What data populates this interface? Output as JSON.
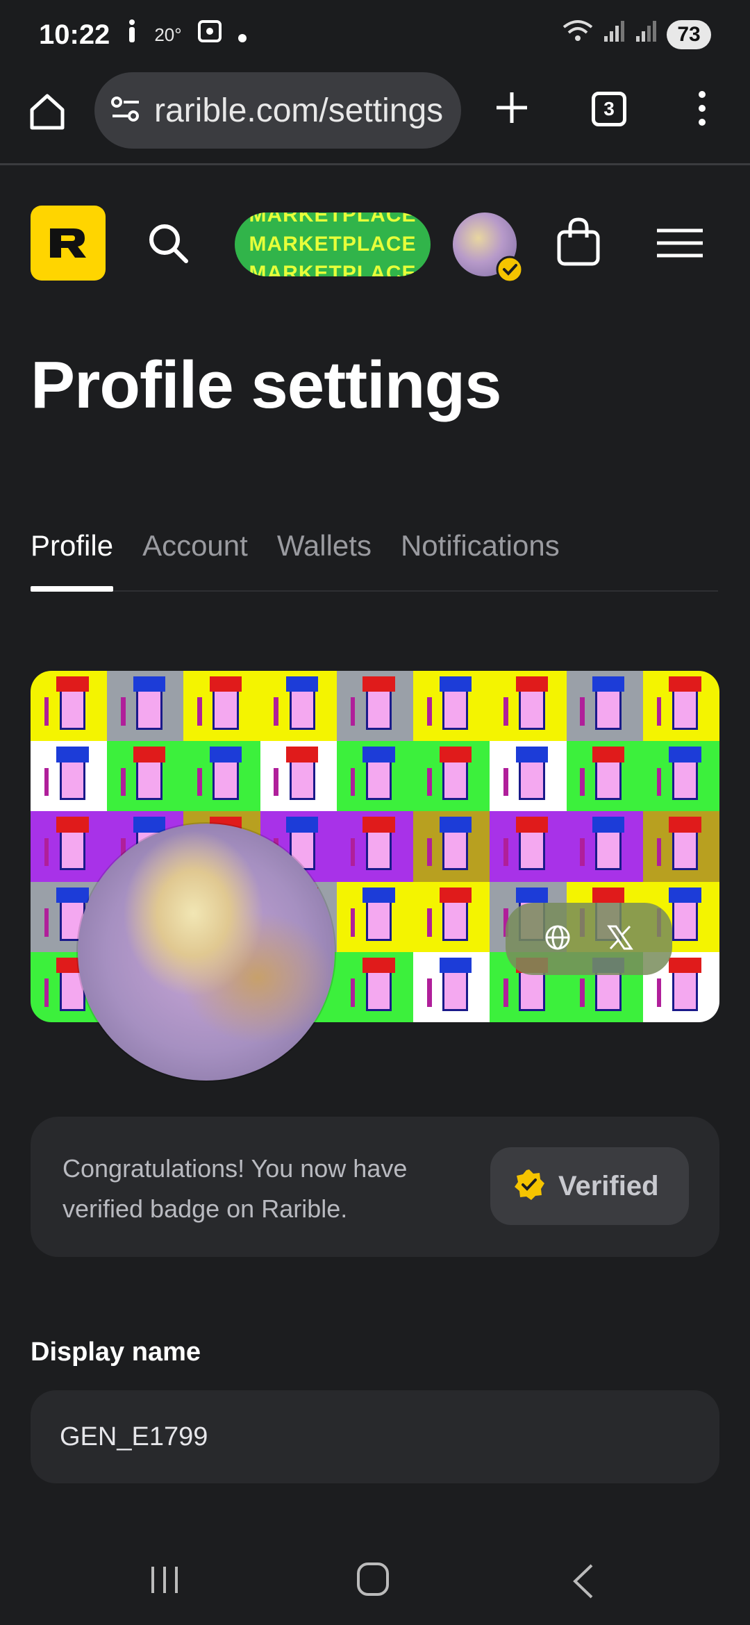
{
  "status": {
    "time": "10:22",
    "temperature": "20°",
    "battery": "73"
  },
  "browser": {
    "url": "rarible.com/settings",
    "tab_count": "3"
  },
  "header": {
    "logo_letter": "R",
    "marketplace_label": "MARKETPLACE"
  },
  "page": {
    "title": "Profile settings"
  },
  "tabs": [
    {
      "label": "Profile",
      "active": true
    },
    {
      "label": "Account",
      "active": false
    },
    {
      "label": "Wallets",
      "active": false
    },
    {
      "label": "Notifications",
      "active": false
    }
  ],
  "verify": {
    "message": "Congratulations! You now have verified badge on Rarible.",
    "badge_label": "Verified"
  },
  "form": {
    "display_name_label": "Display name",
    "display_name_value": "GEN_E1799"
  },
  "colors": {
    "background": "#1c1d1f",
    "accent_yellow": "#ffd500",
    "marketplace_green": "#31b44a",
    "card": "#28292c"
  }
}
